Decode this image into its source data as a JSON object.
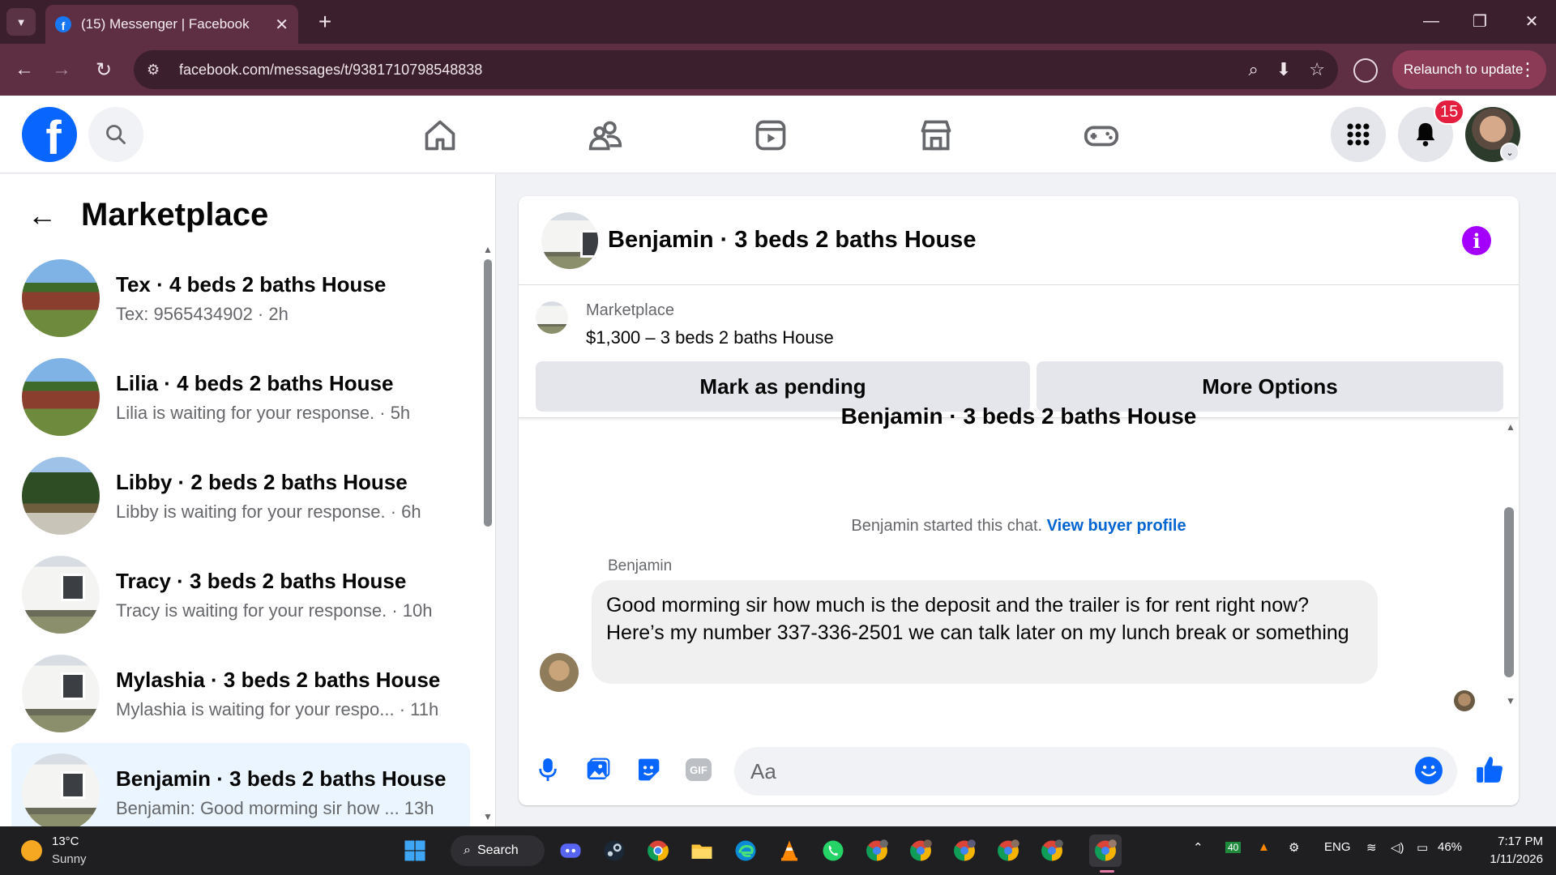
{
  "browser": {
    "tab_title": "(15) Messenger | Facebook",
    "url": "facebook.com/messages/t/9381710798548838",
    "relaunch_label": "Relaunch to update"
  },
  "fb_header": {
    "notification_count": "15"
  },
  "left_panel": {
    "title": "Marketplace",
    "conversations": [
      {
        "name": "Tex · 4 beds 2 baths House",
        "preview": "Tex: 9565434902 · 2h",
        "thumb": "brick"
      },
      {
        "name": "Lilia · 4 beds 2 baths House",
        "preview": "Lilia is waiting for your response. · 5h",
        "thumb": "brick"
      },
      {
        "name": "Libby · 2 beds 2 baths House",
        "preview": "Libby is waiting for your response. · 6h",
        "thumb": "pine"
      },
      {
        "name": "Tracy · 3 beds 2 baths House",
        "preview": "Tracy is waiting for your response. · 10h",
        "thumb": "mobile"
      },
      {
        "name": "Mylashia · 3 beds 2 baths House",
        "preview": "Mylashia is waiting for your respo...  · 11h",
        "thumb": "mobile"
      },
      {
        "name": "Benjamin · 3 beds 2 baths House",
        "preview": "Benjamin: Good morming sir how ...  13h",
        "thumb": "mobile",
        "active": true
      }
    ]
  },
  "chat": {
    "title": "Benjamin · 3 beds 2 baths House",
    "listing_label": "Marketplace",
    "listing_price": "$1,300 – 3 beds 2 baths House",
    "mark_pending_label": "Mark as pending",
    "more_options_label": "More Options",
    "partial_title": "Benjamin · 3 beds 2 baths House",
    "started_text": "Benjamin started this chat.",
    "buyer_profile_link": "View buyer profile",
    "sender_name": "Benjamin",
    "message": "Good morming sir how much is the deposit and the trailer is for rent right now? Here’s my number 337-336-2501 we can talk later on my lunch break or something",
    "input_placeholder": "Aa"
  },
  "taskbar": {
    "weather_temp": "13°C",
    "weather_condition": "Sunny",
    "search_label": "Search",
    "language": "ENG",
    "battery": "46%",
    "time": "7:17 PM",
    "date": "1/11/2026",
    "tray_badge": "40"
  },
  "colors": {
    "fb_blue": "#0866ff",
    "messenger_purple": "#a400ff",
    "browser_frame": "#5e2e43",
    "active_conversation": "#ebf5ff"
  }
}
